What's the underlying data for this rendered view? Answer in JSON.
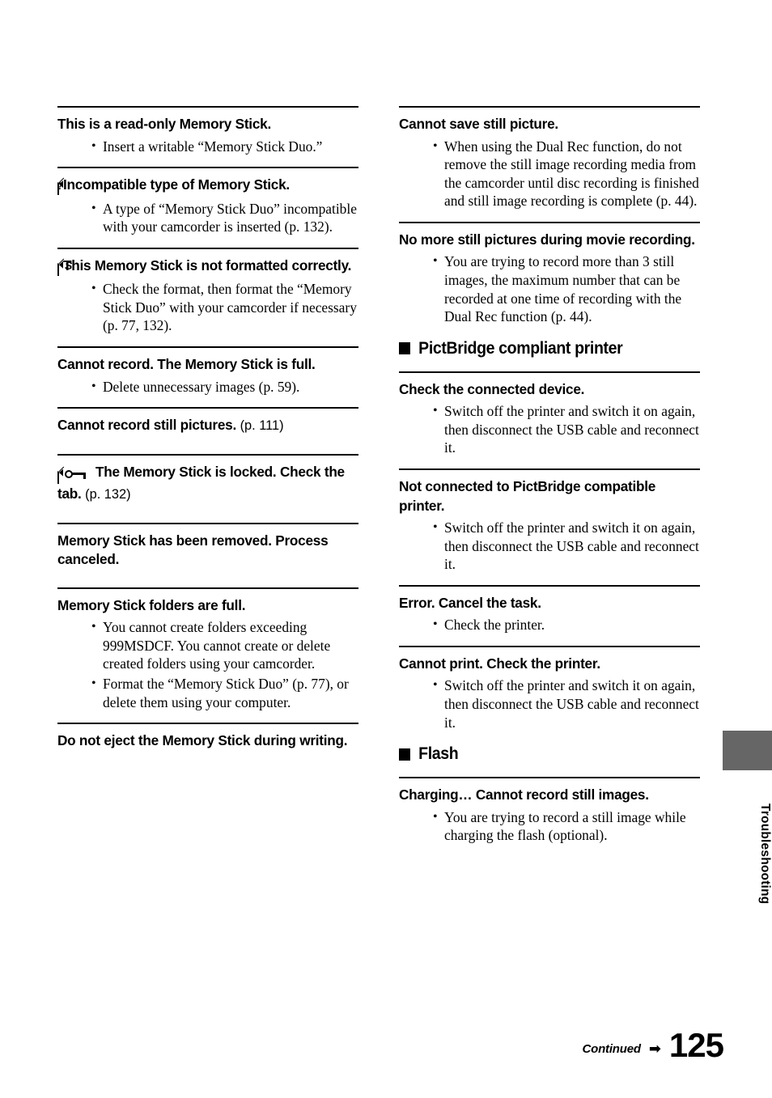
{
  "page": {
    "number": "125",
    "continued_label": "Continued",
    "continued_arrow": "➡",
    "side_tab_label": "Troubleshooting",
    "side_tab_color": "#666666"
  },
  "left_column": {
    "entries": [
      {
        "id": "read-only-memory-stick",
        "icon": null,
        "heading": "This is a read-only Memory Stick.",
        "suffix": "",
        "bullets": [
          "Insert a writable “Memory Stick Duo.”"
        ]
      },
      {
        "id": "incompatible-type",
        "icon": "memory-stick-question-icon",
        "heading": "Incompatible type of Memory Stick.",
        "suffix": "",
        "bullets": [
          "A type of “Memory Stick Duo” incompatible with your camcorder is inserted (p. 132)."
        ]
      },
      {
        "id": "not-formatted-correctly",
        "icon": "memory-stick-format-icon",
        "heading": "This Memory Stick is not formatted correctly.",
        "suffix": "",
        "bullets": [
          "Check the format, then format the “Memory Stick Duo” with your camcorder if necessary (p. 77, 132)."
        ]
      },
      {
        "id": "memory-stick-full",
        "icon": null,
        "heading": "Cannot record. The Memory Stick is full.",
        "suffix": "",
        "bullets": [
          "Delete unnecessary images (p. 59)."
        ]
      },
      {
        "id": "cannot-record-still-pictures",
        "icon": null,
        "heading": "Cannot record still pictures.",
        "suffix": "(p. 111)",
        "bullets": []
      },
      {
        "id": "memory-stick-locked",
        "icon": "memory-stick-key-icon",
        "heading": "The Memory Stick is locked. Check the tab.",
        "suffix": "(p. 132)",
        "bullets": []
      },
      {
        "id": "memory-stick-removed",
        "icon": null,
        "heading": "Memory Stick has been removed. Process canceled.",
        "suffix": "",
        "bullets": []
      },
      {
        "id": "memory-stick-folders-full",
        "icon": null,
        "heading": "Memory Stick folders are full.",
        "suffix": "",
        "bullets": [
          "You cannot create folders exceeding 999MSDCF. You cannot create or delete created folders using your camcorder.",
          "Format the “Memory Stick Duo” (p. 77), or delete them using your computer."
        ]
      },
      {
        "id": "do-not-eject",
        "icon": null,
        "heading": "Do not eject the Memory Stick during writing.",
        "suffix": "",
        "bullets": []
      }
    ]
  },
  "right_column": {
    "entries": [
      {
        "id": "cannot-save-still-picture",
        "type": "message",
        "icon": null,
        "heading": "Cannot save still picture.",
        "suffix": "",
        "bullets": [
          "When using the Dual Rec function, do not remove the still image recording media from the camcorder until disc recording is finished and still image recording is complete (p. 44)."
        ]
      },
      {
        "id": "no-more-still-pictures",
        "type": "message",
        "icon": null,
        "heading": "No more still pictures during movie recording.",
        "suffix": "",
        "bullets": [
          "You are trying to record more than 3 still images, the maximum number that can be recorded at one time of recording with the Dual Rec function (p. 44)."
        ]
      },
      {
        "id": "pictbridge-compliant-printer",
        "type": "section",
        "heading": "PictBridge compliant printer"
      },
      {
        "id": "check-connected-device",
        "type": "message",
        "icon": null,
        "heading": "Check the connected device.",
        "suffix": "",
        "bullets": [
          "Switch off the printer and switch it on again, then disconnect the USB cable and reconnect it."
        ]
      },
      {
        "id": "not-connected-to-pictbridge",
        "type": "message",
        "icon": null,
        "heading": "Not connected to PictBridge compatible printer.",
        "suffix": "",
        "bullets": [
          "Switch off the printer and switch it on again, then disconnect the USB cable and reconnect it."
        ]
      },
      {
        "id": "error-cancel-task",
        "type": "message",
        "icon": null,
        "heading": "Error. Cancel the task.",
        "suffix": "",
        "bullets": [
          "Check the printer."
        ]
      },
      {
        "id": "cannot-print-check-printer",
        "type": "message",
        "icon": null,
        "heading": "Cannot print. Check the printer.",
        "suffix": "",
        "bullets": [
          "Switch off the printer and switch it on again, then disconnect the USB cable and reconnect it."
        ]
      },
      {
        "id": "flash",
        "type": "section",
        "heading": "Flash"
      },
      {
        "id": "charging-cannot-record",
        "type": "message",
        "icon": null,
        "heading": "Charging… Cannot record still images.",
        "suffix": "",
        "bullets": [
          "You are trying to record a still image while charging the flash (optional)."
        ]
      }
    ]
  },
  "icons": {
    "memory-stick-question-icon": "?",
    "memory-stick-format-icon": "ʑ",
    "memory-stick-key-icon": "key"
  }
}
